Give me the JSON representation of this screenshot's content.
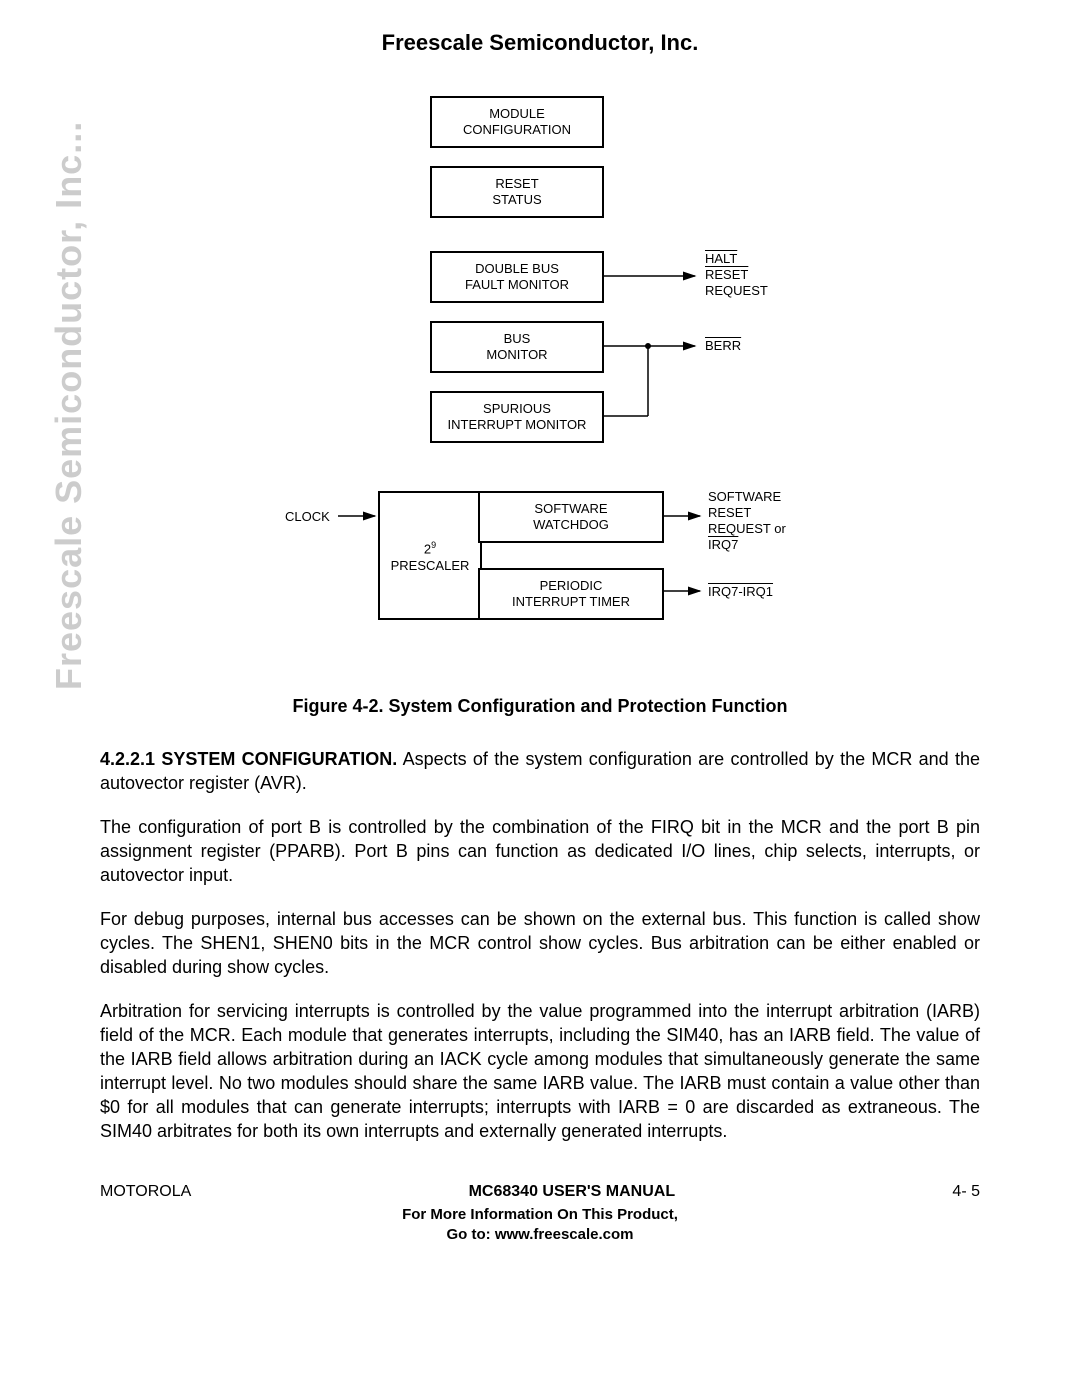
{
  "header": {
    "title": "Freescale Semiconductor, Inc."
  },
  "watermark": "Freescale Semiconductor, Inc...",
  "diagram": {
    "boxes": {
      "module_config": {
        "line1": "MODULE",
        "line2": "CONFIGURATION"
      },
      "reset_status": {
        "line1": "RESET",
        "line2": "STATUS"
      },
      "dbus_fault": {
        "line1": "DOUBLE  BUS",
        "line2": "FAULT MONITOR"
      },
      "bus_monitor": {
        "line1": "BUS",
        "line2": "MONITOR"
      },
      "spurious": {
        "line1": "SPURIOUS",
        "line2": "INTERRUPT MONITOR"
      },
      "prescaler": {
        "line1": "2",
        "line2": "PRESCALER",
        "exp": "9"
      },
      "sw_watchdog": {
        "line1": "SOFTWARE",
        "line2": "WATCHDOG"
      },
      "pit": {
        "line1": "PERIODIC",
        "line2": "INTERRUPT TIMER"
      }
    },
    "labels": {
      "clock": "CLOCK",
      "halt": "HALT",
      "reset": "RESET",
      "request": "REQUEST",
      "berr": "BERR",
      "sw_reset_l1": "SOFTWARE",
      "sw_reset_l2": "RESET",
      "sw_reset_l3": "REQUEST or",
      "sw_reset_l4": "IRQ7",
      "irq_out": "IRQ7-IRQ1"
    }
  },
  "figure_caption": "Figure 4-2. System Configuration and Protection Function",
  "body": {
    "p1_head": "4.2.2.1 SYSTEM CONFIGURATION.",
    "p1": " Aspects of the system configuration are controlled by the MCR and the autovector register (AVR).",
    "p2": "The configuration of port B is controlled by the combination of the FIRQ bit in the MCR and the port B pin assignment register (PPARB). Port B pins can function as dedicated I/O lines, chip selects, interrupts, or autovector input.",
    "p3": "For debug purposes, internal bus accesses can be shown on the external bus. This function is called show cycles. The SHEN1, SHEN0 bits in the MCR control show cycles. Bus arbitration can be either enabled or disabled during show cycles.",
    "p4": "Arbitration for servicing interrupts is controlled by the value programmed into the interrupt arbitration (IARB) field of the MCR. Each module that generates interrupts, including the SIM40, has an IARB field. The value of the IARB field allows arbitration during an IACK cycle among modules that simultaneously generate the same interrupt level. No two modules should share the same IARB value. The IARB must contain a value other than $0 for all modules that can generate interrupts; interrupts with IARB = 0 are discarded as extraneous. The SIM40 arbitrates for both its own interrupts and externally generated interrupts."
  },
  "footer": {
    "left": "MOTOROLA",
    "center": "MC68340 USER'S MANUAL",
    "right": "4- 5",
    "info1": "For More Information On This Product,",
    "info2": "Go to: www.freescale.com"
  }
}
